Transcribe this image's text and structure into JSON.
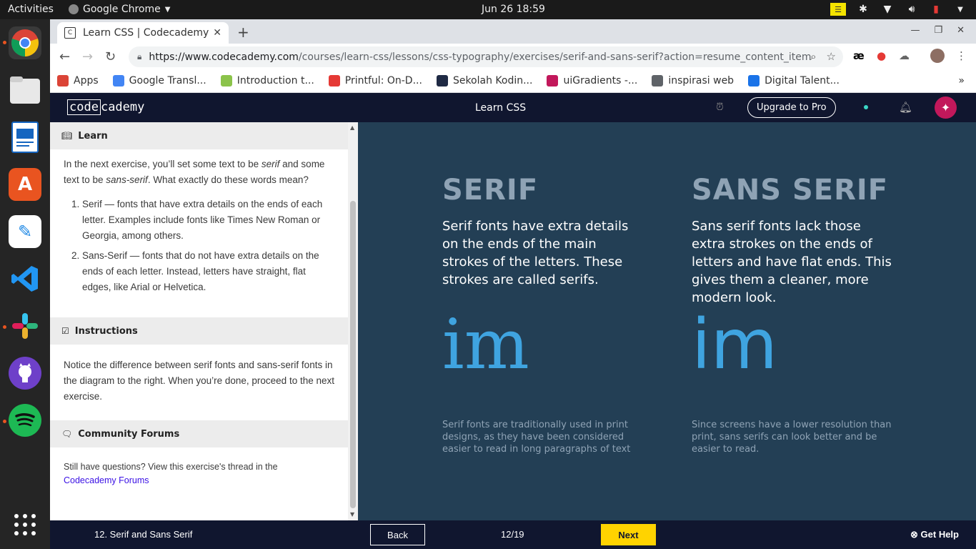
{
  "os": {
    "activities": "Activities",
    "app_name": "Google Chrome",
    "clock": "Jun 26  18:59"
  },
  "browser": {
    "tab_title": "Learn CSS | Codecademy",
    "url_host": "https://www.codecademy.com",
    "url_path": "/courses/learn-css/lessons/css-typography/exercises/serif-and-sans-serif?action=resume_content_item",
    "bookmarks": [
      {
        "label": "Apps",
        "color": "#db4437"
      },
      {
        "label": "Google Transl...",
        "color": "#4285f4"
      },
      {
        "label": "Introduction t...",
        "color": "#8bc34a"
      },
      {
        "label": "Printful: On-D...",
        "color": "#e53935"
      },
      {
        "label": "Sekolah Kodin...",
        "color": "#1f2a44"
      },
      {
        "label": "uiGradients -...",
        "color": "#c2185b"
      },
      {
        "label": "inspirasi web",
        "color": "#5f6368"
      },
      {
        "label": "Digital Talent...",
        "color": "#1a73e8"
      }
    ]
  },
  "header": {
    "logo_code": "code",
    "logo_rest": "cademy",
    "title": "Learn CSS",
    "upgrade_label": "Upgrade to Pro"
  },
  "learn": {
    "heading": "Learn",
    "intro_1": "In the next exercise, you’ll set some text to be ",
    "intro_serif": "serif",
    "intro_2": " and some text to be ",
    "intro_sans": "sans-serif",
    "intro_3": ". What exactly do these words mean?",
    "items": [
      "Serif — fonts that have extra details on the ends of each letter. Examples include fonts like Times New Roman or Georgia, among others.",
      "Sans-Serif — fonts that do not have extra details on the ends of each letter. Instead, letters have straight, flat edges, like Arial or Helvetica."
    ]
  },
  "instructions": {
    "heading": "Instructions",
    "body": "Notice the difference between serif fonts and sans-serif fonts in the diagram to the right. When you’re done, proceed to the next exercise."
  },
  "forums": {
    "heading": "Community Forums",
    "body": "Still have questions? View this exercise's thread in the",
    "link": "Codecademy Forums"
  },
  "diagram": {
    "serif": {
      "title": "SERIF",
      "text": "Serif fonts have extra details on the ends of the main strokes of the letters. These strokes are called serifs.",
      "glyph": "im",
      "note": "Serif fonts are traditionally used in print designs, as they have been considered easier to read in long paragraphs of text"
    },
    "sans": {
      "title": "SANS SERIF",
      "text": "Sans serif fonts lack those extra strokes on the ends of letters and have flat ends. This gives them a cleaner, more modern look.",
      "glyph": "im",
      "note": "Since screens have a lower resolution than print, sans serifs can look better and be easier to read."
    }
  },
  "footer": {
    "lesson": "12. Serif and Sans Serif",
    "back": "Back",
    "progress": "12/19",
    "next": "Next",
    "help": "Get Help"
  }
}
